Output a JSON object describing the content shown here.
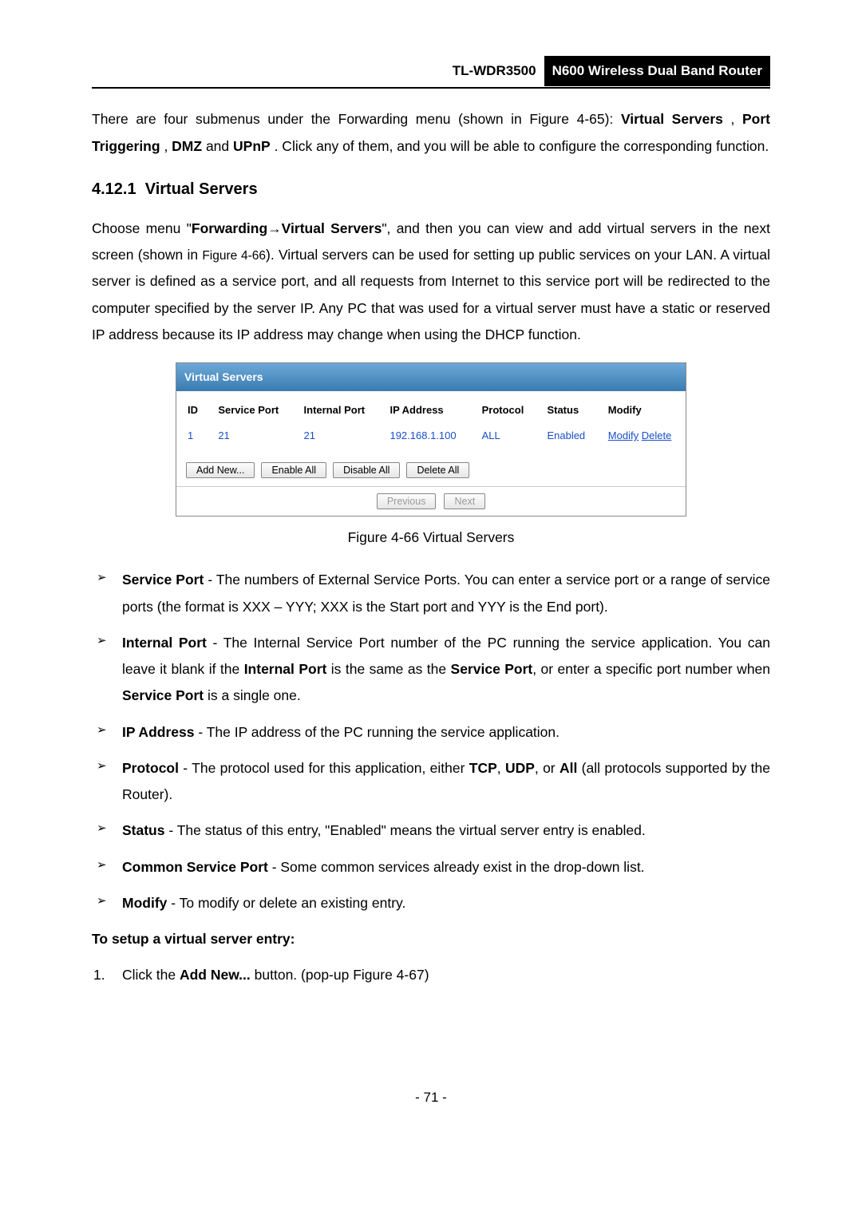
{
  "header": {
    "model": "TL-WDR3500",
    "product": "N600 Wireless Dual Band Router"
  },
  "intro": {
    "pre": "There are four submenus under the Forwarding menu (shown in Figure 4-65): ",
    "m1": "Virtual Servers",
    "sep1": ", ",
    "m2": "Port Triggering",
    "sep2": ", ",
    "m3": "DMZ",
    "sep3": " and ",
    "m4": "UPnP",
    "post": ". Click any of them, and you will be able to configure the corresponding function."
  },
  "section": {
    "num": "4.12.1",
    "title": "Virtual Servers"
  },
  "desc": {
    "pre": "Choose menu \"",
    "m1": "Forwarding",
    "arrow": "→",
    "m2": "Virtual Servers",
    "post1": "\", and then you can view and add virtual servers in the next screen (shown in ",
    "figref": "Figure 4-66",
    "post2": "). Virtual servers can be used for setting up public services on your LAN. A virtual server is defined as a service port, and all requests from Internet to this service port will be redirected to the computer specified by the server IP. Any PC that was used for a virtual server must have a static or reserved IP address because its IP address may change when using the DHCP function."
  },
  "figure": {
    "panel_title": "Virtual Servers",
    "headers": {
      "id": "ID",
      "service_port": "Service Port",
      "internal_port": "Internal Port",
      "ip_address": "IP Address",
      "protocol": "Protocol",
      "status": "Status",
      "modify": "Modify"
    },
    "rows": [
      {
        "id": "1",
        "service_port": "21",
        "internal_port": "21",
        "ip_address": "192.168.1.100",
        "protocol": "ALL",
        "status": "Enabled",
        "modify_link": "Modify",
        "delete_link": "Delete"
      }
    ],
    "buttons": {
      "add": "Add New...",
      "enable_all": "Enable All",
      "disable_all": "Disable All",
      "delete_all": "Delete All",
      "previous": "Previous",
      "next": "Next"
    },
    "caption": "Figure 4-66 Virtual Servers"
  },
  "bullets": [
    {
      "term": "Service Port",
      "text": " - The numbers of External Service Ports. You can enter a service port or a range of service ports (the format is XXX – YYY; XXX is the Start port and YYY is the End port)."
    },
    {
      "term": "Internal Port",
      "pre": " - The Internal Service Port number of the PC running the service application. You can leave it blank if the ",
      "b1": "Internal Port",
      "mid": " is the same as the ",
      "b2": "Service Port",
      "post": ", or enter a specific port number when ",
      "b3": "Service Port",
      "tail": " is a single one."
    },
    {
      "term": "IP Address",
      "text": " - The IP address of the PC running the service application."
    },
    {
      "term": "Protocol",
      "pre": " - The protocol used for this application, either ",
      "b1": "TCP",
      "sep1": ", ",
      "b2": "UDP",
      "sep2": ", or ",
      "b3": "All",
      "post": " (all protocols supported by the Router)."
    },
    {
      "term": "Status",
      "text": " - The status of this entry, \"Enabled\" means the virtual server entry is enabled."
    },
    {
      "term": "Common Service Port",
      "text": " - Some common services already exist in the drop-down list."
    },
    {
      "term": "Modify",
      "text": " - To modify or delete an existing entry."
    }
  ],
  "setup_heading": "To setup a virtual server entry:",
  "step1": {
    "num": "1.",
    "pre": "Click the ",
    "btn": "Add New...",
    "post": " button. (pop-up Figure 4-67)"
  },
  "page_number": "- 71 -"
}
